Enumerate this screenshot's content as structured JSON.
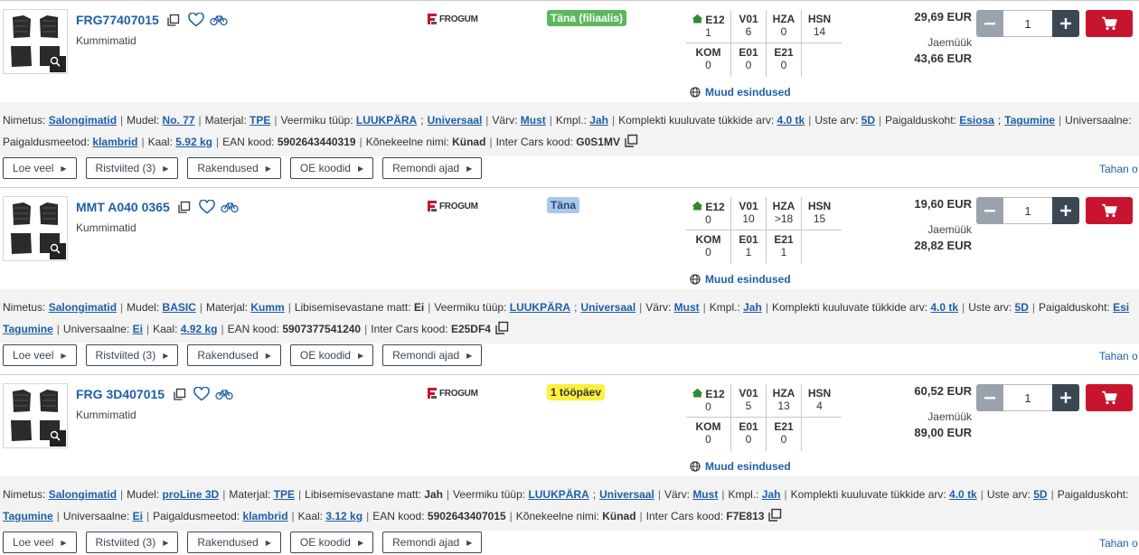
{
  "colors": {
    "accent": "#1f5fa7",
    "cart": "#c8152f",
    "stock_green": "#5cb85c",
    "stock_blue": "#a9c8ee",
    "stock_yellow": "#fbf13d"
  },
  "common": {
    "more_reps": "Muud esindused",
    "retail_label": "Jaemüük",
    "right_link": "Tahan o",
    "buttons": [
      "Loe veel",
      "Ristviited (3)",
      "Rakendused",
      "OE koodid",
      "Remondi ajad"
    ],
    "brand": "FROGUM"
  },
  "products": [
    {
      "code": "FRG77407015",
      "name": "Kummimatid",
      "stock_badge": "Täna (filiaalis)",
      "stock_color": "green",
      "price": "29,69 EUR",
      "retail": "43,66 EUR",
      "qty": "1",
      "stock": {
        "row1": [
          {
            "code": "E12",
            "val": "1",
            "home": true
          },
          {
            "code": "V01",
            "val": "6"
          },
          {
            "code": "HZA",
            "val": "0"
          },
          {
            "code": "HSN",
            "val": "14"
          }
        ],
        "row2": [
          {
            "code": "KOM",
            "val": "0"
          },
          {
            "code": "E01",
            "val": "0"
          },
          {
            "code": "E21",
            "val": "0"
          },
          {
            "code": "",
            "val": ""
          }
        ]
      },
      "attr_line1": [
        {
          "k": "Nimetus:",
          "v": [
            "Salongimatid"
          ],
          "link": true
        },
        {
          "k": "Mudel:",
          "v": [
            "No. 77"
          ],
          "link": true
        },
        {
          "k": "Materjal:",
          "v": [
            "TPE"
          ],
          "link": true
        },
        {
          "k": "Veermiku tüüp:",
          "v": [
            "LUUKPÄRA",
            "Universaal"
          ],
          "link": true
        },
        {
          "k": "Värv:",
          "v": [
            "Must"
          ],
          "link": true
        },
        {
          "k": "Kmpl.:",
          "v": [
            "Jah"
          ],
          "link": true
        },
        {
          "k": "Komplekti kuuluvate tükkide arv:",
          "v": [
            "4.0 tk"
          ],
          "link": true
        },
        {
          "k": "Uste arv:",
          "v": [
            "5D"
          ],
          "link": true
        },
        {
          "k": "Paigalduskoht:",
          "v": [
            "Esiosa",
            "Tagumine"
          ],
          "link": true
        },
        {
          "k": "Universaalne:",
          "v": [],
          "link": true
        }
      ],
      "attr_line2": [
        {
          "k": "Paigaldusmeetod:",
          "v": [
            "klambrid"
          ],
          "link": true
        },
        {
          "k": "Kaal:",
          "v": [
            "5.92 kg"
          ],
          "link": true
        },
        {
          "k": "EAN kood:",
          "v": [
            "5902643440319"
          ],
          "link": false
        },
        {
          "k": "Kõnekeelne nimi:",
          "v": [
            "Künad"
          ],
          "link": false
        },
        {
          "k": "Inter Cars kood:",
          "v": [
            "G0S1MV"
          ],
          "link": false,
          "copy": true
        }
      ]
    },
    {
      "code": "MMT A040 0365",
      "name": "Kummimatid",
      "stock_badge": "Täna",
      "stock_color": "blue",
      "price": "19,60 EUR",
      "retail": "28,82 EUR",
      "qty": "1",
      "stock": {
        "row1": [
          {
            "code": "E12",
            "val": "0",
            "home": true
          },
          {
            "code": "V01",
            "val": "10"
          },
          {
            "code": "HZA",
            "val": ">18"
          },
          {
            "code": "HSN",
            "val": "15"
          }
        ],
        "row2": [
          {
            "code": "KOM",
            "val": "0"
          },
          {
            "code": "E01",
            "val": "1"
          },
          {
            "code": "E21",
            "val": "1"
          },
          {
            "code": "",
            "val": ""
          }
        ]
      },
      "attr_line1": [
        {
          "k": "Nimetus:",
          "v": [
            "Salongimatid"
          ],
          "link": true
        },
        {
          "k": "Mudel:",
          "v": [
            "BASIC"
          ],
          "link": true
        },
        {
          "k": "Materjal:",
          "v": [
            "Kumm"
          ],
          "link": true
        },
        {
          "k": "Libisemisevastane matt:",
          "v": [
            "Ei"
          ],
          "link": false
        },
        {
          "k": "Veermiku tüüp:",
          "v": [
            "LUUKPÄRA",
            "Universaal"
          ],
          "link": true
        },
        {
          "k": "Värv:",
          "v": [
            "Must"
          ],
          "link": true
        },
        {
          "k": "Kmpl.:",
          "v": [
            "Jah"
          ],
          "link": true
        },
        {
          "k": "Komplekti kuuluvate tükkide arv:",
          "v": [
            "4.0 tk"
          ],
          "link": true
        },
        {
          "k": "Uste arv:",
          "v": [
            "5D"
          ],
          "link": true
        },
        {
          "k": "Paigalduskoht:",
          "v": [
            "Esi"
          ],
          "link": true
        }
      ],
      "attr_line2": [
        {
          "k": "",
          "v": [
            "Tagumine"
          ],
          "link": true
        },
        {
          "k": "Universaalne:",
          "v": [
            "Ei"
          ],
          "link": true
        },
        {
          "k": "Kaal:",
          "v": [
            "4.92 kg"
          ],
          "link": true
        },
        {
          "k": "EAN kood:",
          "v": [
            "5907377541240"
          ],
          "link": false
        },
        {
          "k": "Inter Cars kood:",
          "v": [
            "E25DF4"
          ],
          "link": false,
          "copy": true
        }
      ]
    },
    {
      "code": "FRG 3D407015",
      "name": "Kummimatid",
      "stock_badge": "1 tööpäev",
      "stock_color": "yellow",
      "price": "60,52 EUR",
      "retail": "89,00 EUR",
      "qty": "1",
      "stock": {
        "row1": [
          {
            "code": "E12",
            "val": "0",
            "home": true
          },
          {
            "code": "V01",
            "val": "5"
          },
          {
            "code": "HZA",
            "val": "13"
          },
          {
            "code": "HSN",
            "val": "4"
          }
        ],
        "row2": [
          {
            "code": "KOM",
            "val": "0"
          },
          {
            "code": "E01",
            "val": "0"
          },
          {
            "code": "E21",
            "val": "0"
          },
          {
            "code": "",
            "val": ""
          }
        ]
      },
      "attr_line1": [
        {
          "k": "Nimetus:",
          "v": [
            "Salongimatid"
          ],
          "link": true
        },
        {
          "k": "Mudel:",
          "v": [
            "proLine 3D"
          ],
          "link": true
        },
        {
          "k": "Materjal:",
          "v": [
            "TPE"
          ],
          "link": true
        },
        {
          "k": "Libisemisevastane matt:",
          "v": [
            "Jah"
          ],
          "link": false
        },
        {
          "k": "Veermiku tüüp:",
          "v": [
            "LUUKPÄRA",
            "Universaal"
          ],
          "link": true
        },
        {
          "k": "Värv:",
          "v": [
            "Must"
          ],
          "link": true
        },
        {
          "k": "Kmpl.:",
          "v": [
            "Jah"
          ],
          "link": true
        },
        {
          "k": "Komplekti kuuluvate tükkide arv:",
          "v": [
            "4.0 tk"
          ],
          "link": true
        },
        {
          "k": "Uste arv:",
          "v": [
            "5D"
          ],
          "link": true
        },
        {
          "k": "Paigalduskoht:",
          "v": [],
          "link": true
        }
      ],
      "attr_line2": [
        {
          "k": "",
          "v": [
            "Tagumine"
          ],
          "link": true
        },
        {
          "k": "Universaalne:",
          "v": [
            "Ei"
          ],
          "link": true
        },
        {
          "k": "Paigaldusmeetod:",
          "v": [
            "klambrid"
          ],
          "link": true
        },
        {
          "k": "Kaal:",
          "v": [
            "3.12 kg"
          ],
          "link": true
        },
        {
          "k": "EAN kood:",
          "v": [
            "5902643407015"
          ],
          "link": false
        },
        {
          "k": "Kõnekeelne nimi:",
          "v": [
            "Künad"
          ],
          "link": false
        },
        {
          "k": "Inter Cars kood:",
          "v": [
            "F7E813"
          ],
          "link": false,
          "copy": true
        }
      ]
    }
  ]
}
